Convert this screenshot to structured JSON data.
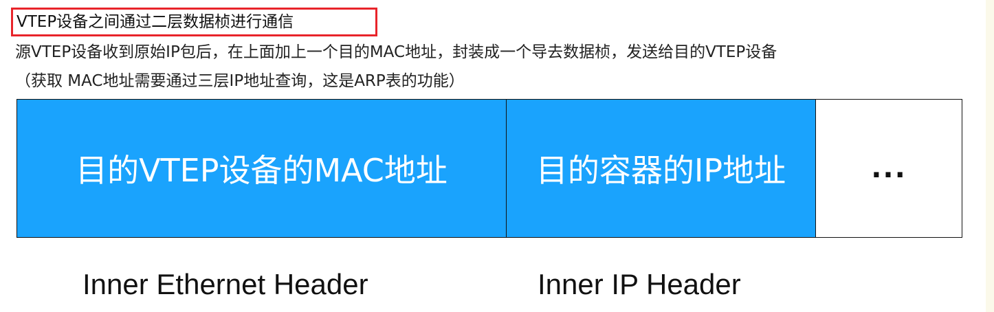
{
  "title": "VTEP设备之间通过二层数据桢进行通信",
  "description": {
    "line1": "源VTEP设备收到原始IP包后，在上面加上一个目的MAC地址，封装成一个导去数据桢，发送给目的VTEP设备",
    "line2": "（获取 MAC地址需要通过三层IP地址查询，这是ARP表的功能）"
  },
  "frame": {
    "segments": [
      {
        "label": "目的VTEP设备的MAC地址",
        "color": "#1aa3fd"
      },
      {
        "label": "目的容器的IP地址",
        "color": "#1aa3fd"
      },
      {
        "label": "...",
        "color": "#ffffff"
      }
    ]
  },
  "captions": {
    "ethernet": "Inner Ethernet  Header",
    "ip": "Inner IP Header"
  },
  "colors": {
    "highlight_border": "#e8242a",
    "segment_fill": "#1aa3fd"
  }
}
